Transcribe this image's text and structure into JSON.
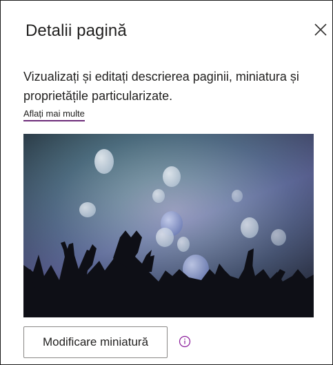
{
  "panel": {
    "title": "Detalii pagină",
    "close_icon": "close-icon",
    "description": "Vizualizați și editați descrierea paginii, miniatura și proprietățile particularizate.",
    "learn_more": "Aflați mai multe",
    "thumbnail_icon": "page-thumbnail-image",
    "change_thumbnail": "Modificare miniatură",
    "info_icon": "info-icon",
    "accent_color": "#881798"
  }
}
